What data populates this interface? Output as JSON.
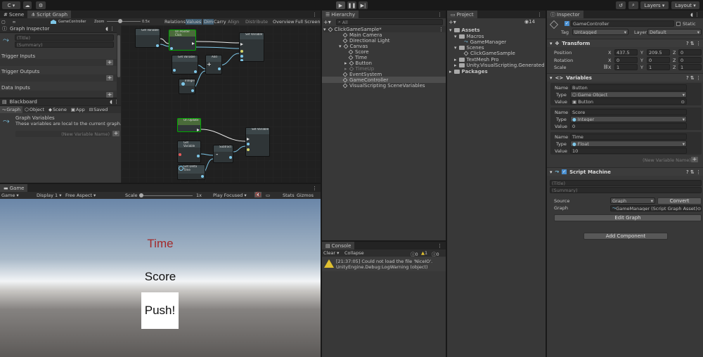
{
  "toolbar": {
    "account": "C",
    "layers": "Layers",
    "layout": "Layout"
  },
  "scene_tabs": {
    "scene": "Scene",
    "script_graph": "Script Graph"
  },
  "graph_toolbar": {
    "graph_name": "GameController",
    "zoom_label": "Zoom",
    "zoom_value": "0.5x",
    "relations": "Relations",
    "values": "Values",
    "dim": "Dim",
    "carry": "Carry",
    "align": "Align",
    "distribute": "Distribute",
    "overview": "Overview",
    "full_screen": "Full Screen"
  },
  "graph_inspector": {
    "header": "Graph Inspector",
    "title_placeholder": "(Title)",
    "summary_placeholder": "(Summary)",
    "trigger_inputs": "Trigger Inputs",
    "trigger_outputs": "Trigger Outputs",
    "data_inputs": "Data Inputs"
  },
  "blackboard": {
    "header": "Blackboard",
    "tabs": [
      "Graph",
      "Object",
      "Scene",
      "App",
      "Saved"
    ],
    "section_title": "Graph Variables",
    "section_desc": "These variables are local to the current graph.",
    "new_var_placeholder": "(New Variable Name)"
  },
  "nodes": {
    "n1": "Get Variable",
    "n2": "On Pointer Click",
    "n3": "Set Variable",
    "n4": "Get Variable",
    "n5": "Add",
    "n6": "Integer",
    "n7": "On Update",
    "n8": "Set Variable",
    "n9": "Get Variable",
    "n10": "Subtract",
    "n11": "Get Delta Time",
    "add_symbol": "+",
    "sub_symbol": "-"
  },
  "game": {
    "tab": "Game",
    "mode": "Game",
    "display": "Display 1",
    "aspect": "Free Aspect",
    "scale_label": "Scale",
    "scale_value": "1x",
    "play_focused": "Play Focused",
    "stats": "Stats",
    "gizmos": "Gizmos",
    "time_text": "Time",
    "score_text": "Score",
    "push_text": "Push!"
  },
  "hierarchy": {
    "tab": "Hierarchy",
    "search_placeholder": "All",
    "root": "ClickGameSample*",
    "items": [
      "Main Camera",
      "Directional Light",
      "Canvas",
      "Score",
      "Time",
      "Button",
      "TimeUp",
      "EventSystem",
      "GameController",
      "VisualScripting SceneVariables"
    ]
  },
  "project": {
    "tab": "Project",
    "count": "14",
    "items": [
      "Assets",
      "Macros",
      "GameManager",
      "Scenes",
      "ClickGameSample",
      "TextMesh Pro",
      "Unity.VisualScripting.Generated",
      "Packages"
    ]
  },
  "console": {
    "tab": "Console",
    "clear": "Clear",
    "collapse": "Collapse",
    "count_info": "0",
    "count_warn": "1",
    "count_err": "0",
    "message_line1": "[21:37:05] Could not load the file 'NiceIO'.",
    "message_line2": "UnityEngine.Debug:LogWarning (object)"
  },
  "inspector": {
    "tab": "Inspector",
    "object_name": "GameController",
    "static_label": "Static",
    "tag_label": "Tag",
    "tag_value": "Untagged",
    "layer_label": "Layer",
    "layer_value": "Default",
    "transform": {
      "title": "Transform",
      "position": "Position",
      "rotation": "Rotation",
      "scale": "Scale",
      "px": "437.5",
      "py": "209.5",
      "pz": "0",
      "rx": "0",
      "ry": "0",
      "rz": "0",
      "sx": "1",
      "sy": "1",
      "sz": "1",
      "x": "X",
      "y": "Y",
      "z": "Z"
    },
    "variables": {
      "title": "Variables",
      "name_label": "Name",
      "type_label": "Type",
      "value_label": "Value",
      "v1_name": "Button",
      "v1_type": "Game Object",
      "v1_value": "Button",
      "v2_name": "Score",
      "v2_type": "Integer",
      "v2_value": "0",
      "v3_name": "Time",
      "v3_type": "Float",
      "v3_value": "10",
      "new_var": "(New Variable Name)"
    },
    "script_machine": {
      "title": "Script Machine",
      "title_placeholder": "(Title)",
      "summary_placeholder": "(Summary)",
      "source_label": "Source",
      "source_value": "Graph",
      "convert": "Convert",
      "graph_label": "Graph",
      "graph_value": "GameManager (Script Graph Asset)",
      "edit_graph": "Edit Graph"
    },
    "add_component": "Add Component"
  }
}
